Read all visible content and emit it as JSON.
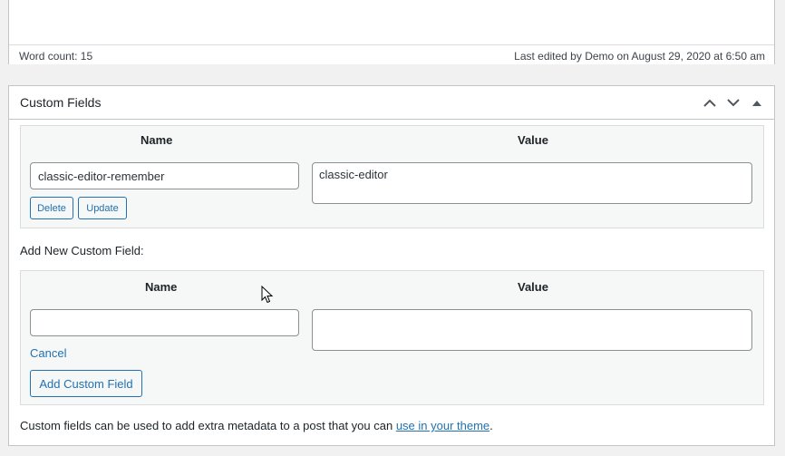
{
  "editor": {
    "word_count": "Word count: 15",
    "last_edited": "Last edited by Demo on August 29, 2020 at 6:50 am"
  },
  "custom_fields": {
    "title": "Custom Fields",
    "header_actions": [
      "move-up-icon",
      "move-down-icon",
      "toggle-panel-icon"
    ],
    "columns": {
      "name": "Name",
      "value": "Value"
    },
    "existing": {
      "name": "classic-editor-remember",
      "value": "classic-editor",
      "delete_label": "Delete",
      "update_label": "Update"
    },
    "add_new": {
      "heading": "Add New Custom Field:",
      "name_col": "Name",
      "value_col": "Value",
      "name_value": "",
      "value_value": "",
      "cancel_label": "Cancel",
      "submit_label": "Add Custom Field"
    },
    "footer": {
      "text": "Custom fields can be used to add extra metadata to a post that you can ",
      "link_text": "use in your theme",
      "end": "."
    }
  },
  "colors": {
    "accent": "#2271b1",
    "border": "#c3c4c7",
    "panel_bg": "#f6f7f7"
  }
}
